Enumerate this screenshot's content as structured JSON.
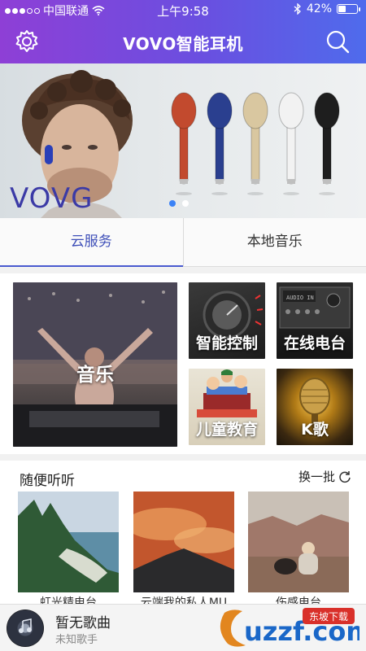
{
  "status_bar": {
    "carrier": "中国联通",
    "time": "上午9:58",
    "battery_percent": "42%",
    "battery_level": 0.42,
    "icons": [
      "signal-dots",
      "wifi-icon",
      "bluetooth-icon",
      "battery-icon"
    ]
  },
  "header": {
    "title": "VOVO智能耳机",
    "left_icon": "gear-icon",
    "right_icon": "search-icon"
  },
  "banner": {
    "brand_text": "VOVG",
    "earbud_colors": [
      "#c24a2e",
      "#2a3f8f",
      "#d9c7a0",
      "#f2f2f2",
      "#1e1e1e"
    ],
    "page_index": 1,
    "page_count": 2
  },
  "tabs": [
    {
      "label": "云服务",
      "active": true
    },
    {
      "label": "本地音乐",
      "active": false
    }
  ],
  "categories": {
    "music": "音乐",
    "smart_control": "智能控制",
    "online_radio": "在线电台",
    "kids_education": "儿童教育",
    "karaoke": "K歌"
  },
  "random_listen": {
    "title": "随便听听",
    "refresh_label": "换一批",
    "cards": [
      {
        "caption": "虹光精电台"
      },
      {
        "caption": "云端我的私人MU"
      },
      {
        "caption": "伤感电台"
      }
    ]
  },
  "player": {
    "song": "暂无歌曲",
    "artist": "未知歌手"
  },
  "watermark": {
    "text": "uzzf.com",
    "badge": "东坡下载"
  },
  "colors": {
    "header_start": "#8e3fd6",
    "header_end": "#4f6bec",
    "tab_active": "#3e4fb8",
    "dot_active": "#3b82f6"
  }
}
